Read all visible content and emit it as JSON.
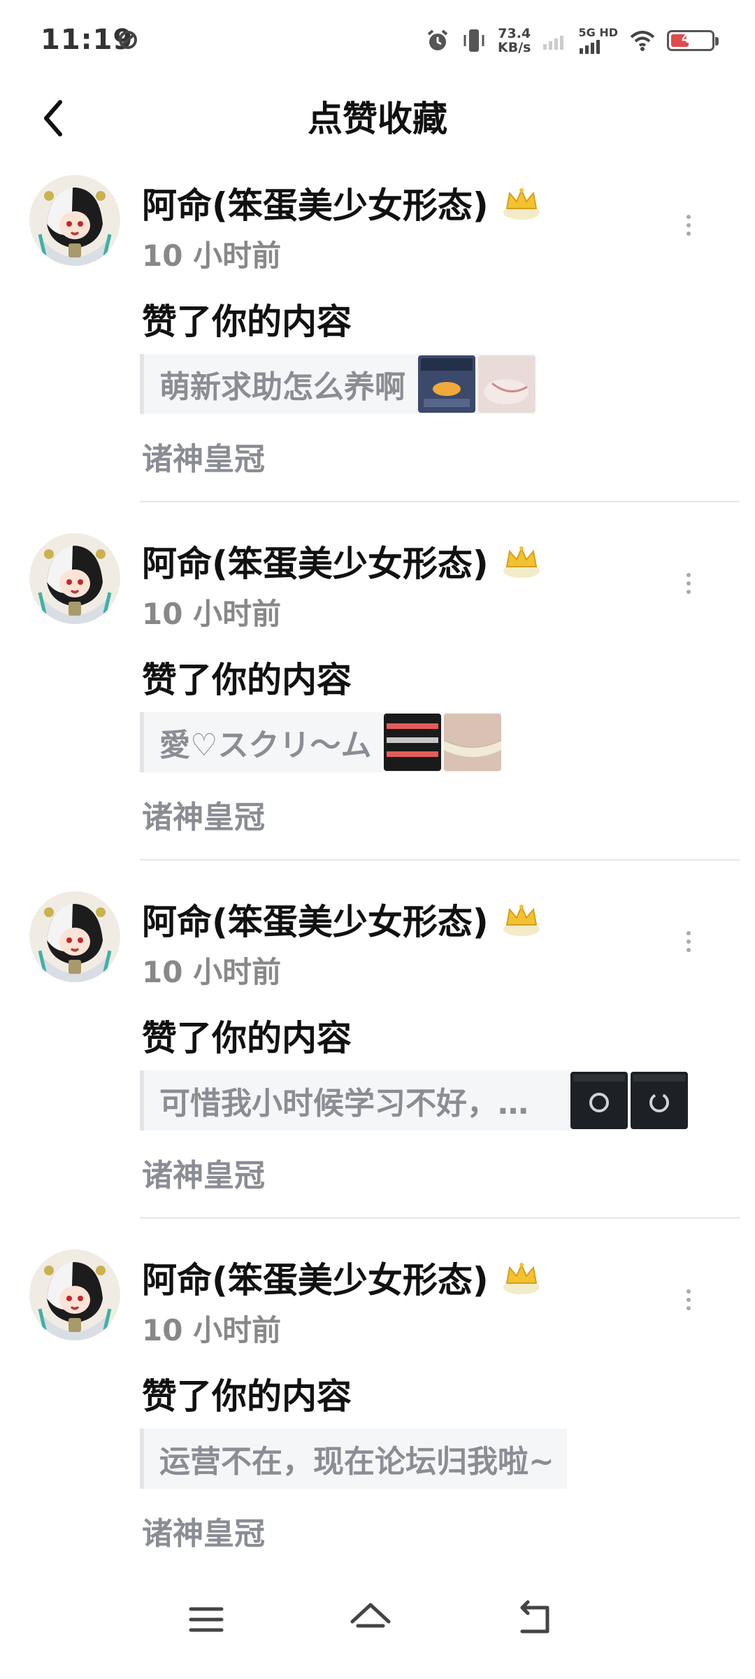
{
  "status_bar": {
    "time": "11:19",
    "net_speed_value": "73.4",
    "net_speed_unit": "KB/s",
    "network_type": "5G HD",
    "battery_level": "41",
    "icons": [
      "do-not-disturb-icon",
      "alarm-icon",
      "vibrate-icon",
      "signal-icon",
      "wifi-icon",
      "battery-icon"
    ]
  },
  "header": {
    "back_icon": "chevron-left-icon",
    "title": "点赞收藏"
  },
  "items": [
    {
      "user": "阿命(笨蛋美少女形态)",
      "time": "10 小时前",
      "action": "赞了你的内容",
      "quote": "萌新求助怎么养啊",
      "tag": "诸神皇冠",
      "thumbs": 2
    },
    {
      "user": "阿命(笨蛋美少女形态)",
      "time": "10 小时前",
      "action": "赞了你的内容",
      "quote": "愛♡スクリ～ム",
      "tag": "诸神皇冠",
      "thumbs": 2
    },
    {
      "user": "阿命(笨蛋美少女形态)",
      "time": "10 小时前",
      "action": "赞了你的内容",
      "quote": "可惜我小时候学习不好，…",
      "tag": "诸神皇冠",
      "thumbs": 2
    },
    {
      "user": "阿命(笨蛋美少女形态)",
      "time": "10 小时前",
      "action": "赞了你的内容",
      "quote": "运营不在，现在论坛归我啦~",
      "tag": "诸神皇冠",
      "thumbs": 0
    }
  ],
  "nav_bar": {
    "icons": [
      "menu-icon",
      "home-icon",
      "back-icon"
    ]
  },
  "colors": {
    "text_primary": "#111111",
    "text_secondary": "#8a8d93",
    "quote_bg": "#f5f6f8",
    "divider": "#e8e8e8"
  }
}
